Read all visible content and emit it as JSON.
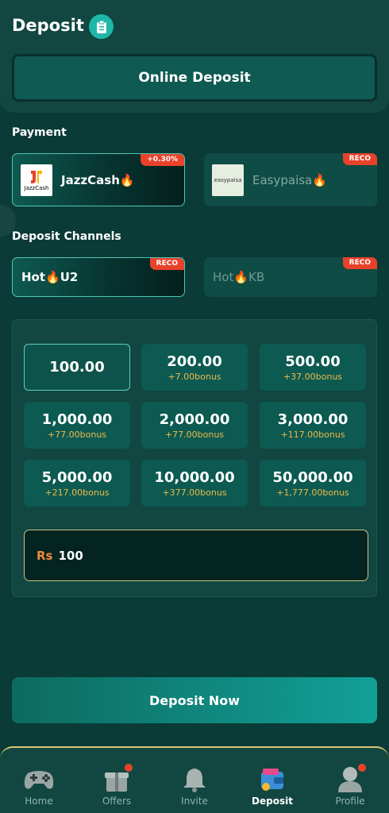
{
  "header": {
    "title": "Deposit",
    "online_deposit_label": "Online Deposit"
  },
  "payment": {
    "section_title": "Payment",
    "methods": [
      {
        "name": "JazzCash🔥",
        "logo_text": "JazzCash",
        "tag": "+0.30%",
        "selected": true
      },
      {
        "name": "Easypaisa🔥",
        "logo_text": "easypaisa",
        "tag": "RECO",
        "selected": false
      }
    ]
  },
  "channels": {
    "section_title": "Deposit Channels",
    "items": [
      {
        "name": "Hot🔥U2",
        "tag": "RECO",
        "selected": true
      },
      {
        "name": "Hot🔥KB",
        "tag": "RECO",
        "selected": false
      }
    ]
  },
  "amounts": [
    {
      "value": "100.00",
      "bonus": "",
      "selected": true
    },
    {
      "value": "200.00",
      "bonus": "+7.00bonus",
      "selected": false
    },
    {
      "value": "500.00",
      "bonus": "+37.00bonus",
      "selected": false
    },
    {
      "value": "1,000.00",
      "bonus": "+77.00bonus",
      "selected": false
    },
    {
      "value": "2,000.00",
      "bonus": "+77.00bonus",
      "selected": false
    },
    {
      "value": "3,000.00",
      "bonus": "+117.00bonus",
      "selected": false
    },
    {
      "value": "5,000.00",
      "bonus": "+217.00bonus",
      "selected": false
    },
    {
      "value": "10,000.00",
      "bonus": "+377.00bonus",
      "selected": false
    },
    {
      "value": "50,000.00",
      "bonus": "+1,777.00bonus",
      "selected": false
    }
  ],
  "amount_input": {
    "currency": "Rs",
    "value": "100"
  },
  "deposit_button_label": "Deposit Now",
  "nav": [
    {
      "label": "Home",
      "icon": "gamepad-icon",
      "active": false,
      "dot": false
    },
    {
      "label": "Offers",
      "icon": "gift-icon",
      "active": false,
      "dot": true
    },
    {
      "label": "Invite",
      "icon": "bell-icon",
      "active": false,
      "dot": false
    },
    {
      "label": "Deposit",
      "icon": "wallet-icon",
      "active": true,
      "dot": false
    },
    {
      "label": "Profile",
      "icon": "user-icon",
      "active": false,
      "dot": true
    }
  ],
  "colors": {
    "background": "#0b3b36",
    "accent": "#1fb7a8",
    "tag": "#e8422b",
    "bonus": "#f0b94a",
    "currency": "#f08a3a"
  }
}
